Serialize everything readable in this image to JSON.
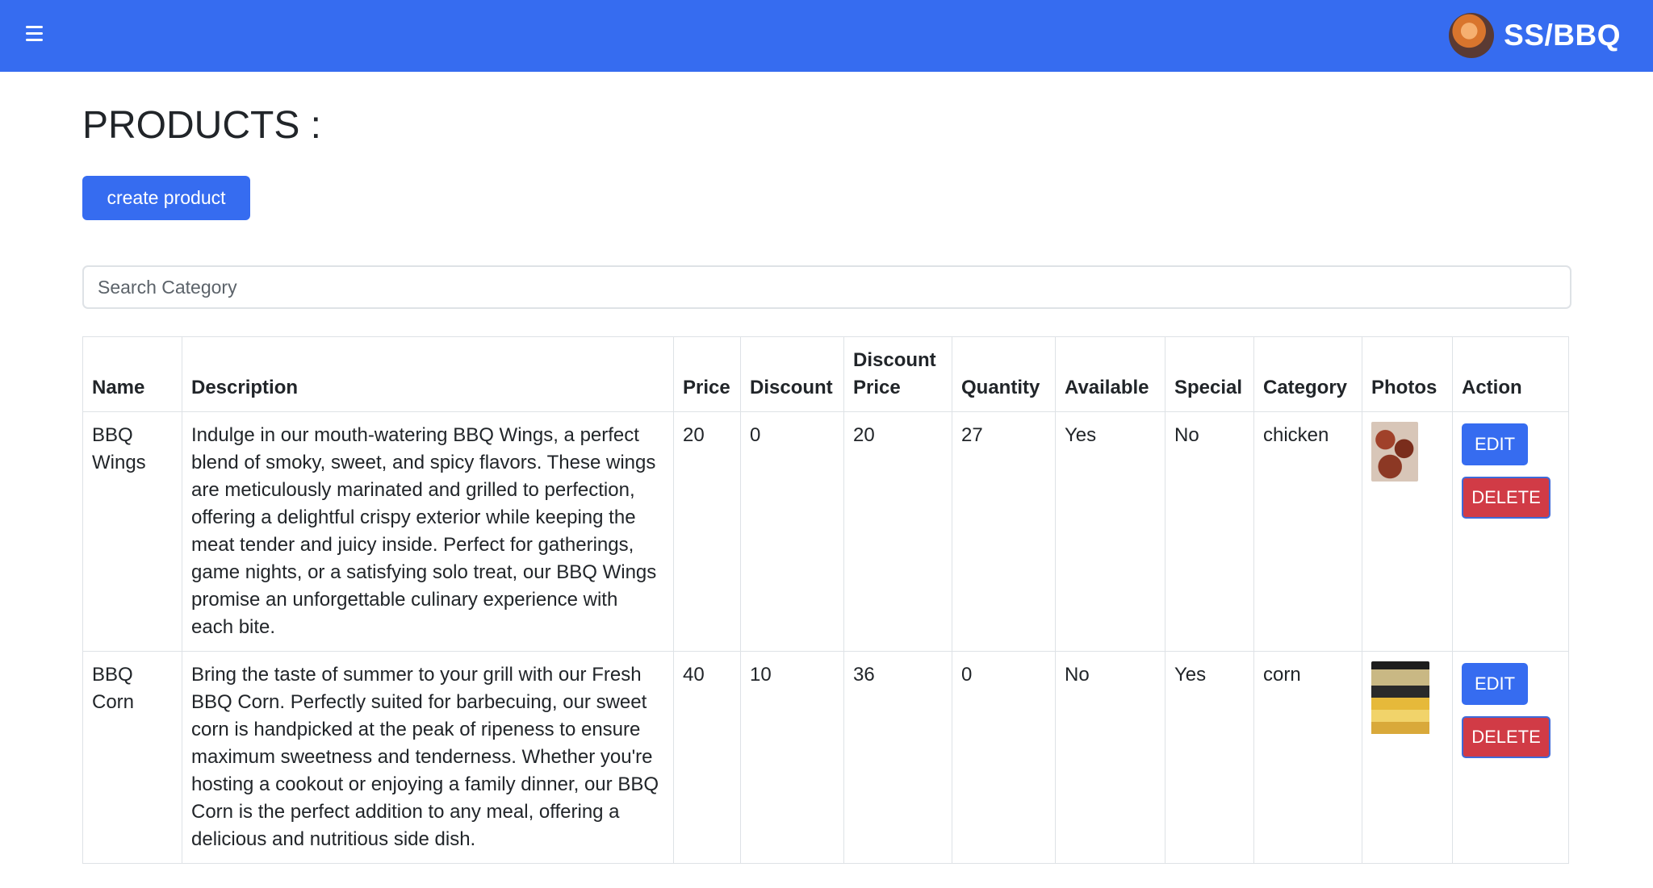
{
  "navbar": {
    "menu_icon": "hamburger-icon",
    "brand_logo": "bbq-chef-logo",
    "brand_name": "SS/BBQ",
    "color": "#366cf0"
  },
  "page": {
    "title": "PRODUCTS :",
    "create_button": "create product",
    "search_placeholder": "Search Category"
  },
  "table": {
    "headers": {
      "name": "Name",
      "description": "Description",
      "price": "Price",
      "discount": "Discount",
      "discount_price_line1": "Discount",
      "discount_price_line2": "Price",
      "quantity": "Quantity",
      "available": "Available",
      "special": "Special",
      "category": "Category",
      "photos": "Photos",
      "action": "Action"
    },
    "rows": [
      {
        "name_line1": "BBQ",
        "name_line2": "Wings",
        "description": "Indulge in our mouth-watering BBQ Wings, a perfect blend of smoky, sweet, and spicy flavors. These wings are meticulously marinated and grilled to perfection, offering a delightful crispy exterior while keeping the meat tender and juicy inside. Perfect for gatherings, game nights, or a satisfying solo treat, our BBQ Wings promise an unforgettable culinary experience with each bite.",
        "price": "20",
        "discount": "0",
        "discount_price": "20",
        "quantity": "27",
        "available": "Yes",
        "special": "No",
        "category": "chicken",
        "photo": "bbq-wings-photo",
        "edit_label": "EDIT",
        "delete_label": "DELETE"
      },
      {
        "name_line1": "BBQ",
        "name_line2": "Corn",
        "description": "Bring the taste of summer to your grill with our Fresh BBQ Corn. Perfectly suited for barbecuing, our sweet corn is handpicked at the peak of ripeness to ensure maximum sweetness and tenderness. Whether you're hosting a cookout or enjoying a family dinner, our BBQ Corn is the perfect addition to any meal, offering a delicious and nutritious side dish.",
        "price": "40",
        "discount": "10",
        "discount_price": "36",
        "quantity": "0",
        "available": "No",
        "special": "Yes",
        "category": "corn",
        "photo": "bbq-corn-photo",
        "edit_label": "EDIT",
        "delete_label": "DELETE"
      }
    ]
  }
}
